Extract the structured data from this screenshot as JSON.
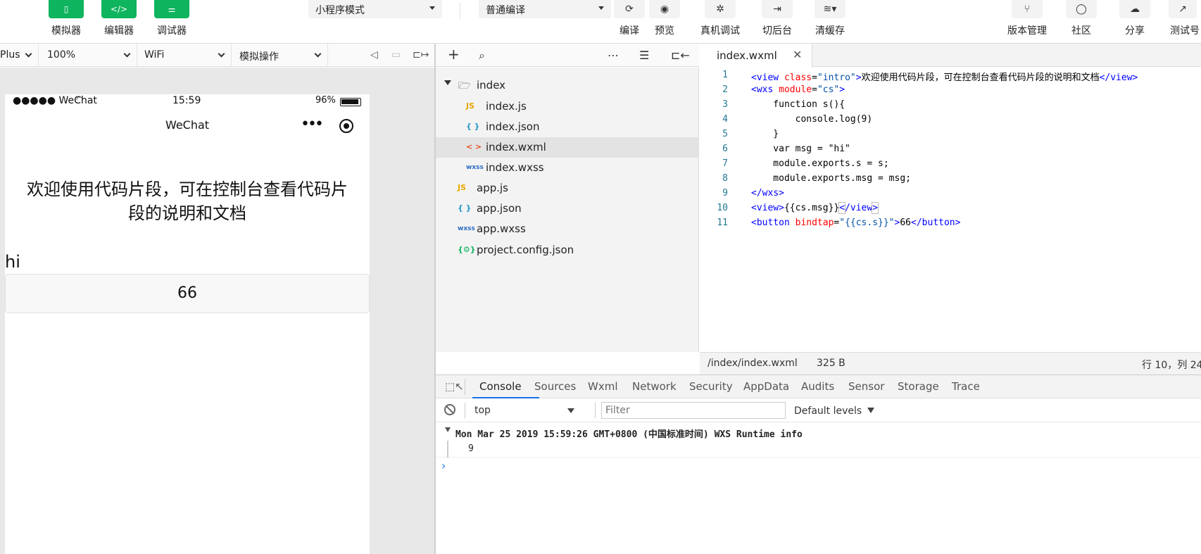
{
  "toolbar": {
    "simulator_label": "模拟器",
    "editor_label": "编辑器",
    "debugger_label": "调试器",
    "mode_select": "小程序模式",
    "compile_select": "普通编译",
    "compile_label": "编译",
    "preview_label": "预览",
    "remote_debug_label": "真机调试",
    "background_label": "切后台",
    "clear_cache_label": "清缓存",
    "version_label": "版本管理",
    "community_label": "社区",
    "share_label": "分享",
    "test_label": "测试号"
  },
  "simbar": {
    "device": "Plus",
    "zoom": "100%",
    "network": "WiFi",
    "operation": "模拟操作"
  },
  "phone": {
    "carrier": "●●●●● WeChat",
    "time": "15:59",
    "battery": "96%",
    "nav_title": "WeChat",
    "intro_text": "欢迎使用代码片段，可在控制台查看代码片段的说明和文档",
    "msg_text": "hi",
    "button_text": "66"
  },
  "tree": {
    "folder": "index",
    "files": [
      {
        "icon": "JS",
        "name": "index.js"
      },
      {
        "icon": "{ }",
        "name": "index.json"
      },
      {
        "icon": "< >",
        "name": "index.wxml"
      },
      {
        "icon": "wxss",
        "name": "index.wxss"
      },
      {
        "icon": "JS",
        "name": "app.js"
      },
      {
        "icon": "{ }",
        "name": "app.json"
      },
      {
        "icon": "wxss",
        "name": "app.wxss"
      },
      {
        "icon": "{⚙}",
        "name": "project.config.json"
      }
    ]
  },
  "editor": {
    "tab_name": "index.wxml",
    "line_numbers": [
      "1",
      "2",
      "3",
      "4",
      "5",
      "6",
      "7",
      "8",
      "9",
      "10",
      "11"
    ],
    "lines": {
      "l1_text": "欢迎使用代码片段，可在控制台查看代码片段的说明和文档",
      "l3": "    function s(){",
      "l4": "        console.log(9)",
      "l5": "    }",
      "l6": "    var msg = \"hi\"",
      "l7": "    module.exports.s = s;",
      "l8": "    module.exports.msg = msg;",
      "l10_text": "{{cs.msg}}",
      "l11_text": "66"
    },
    "status_path": "/index/index.wxml",
    "status_size": "325 B",
    "status_pos": "行 10，列 24"
  },
  "devtools": {
    "tabs": [
      "Console",
      "Sources",
      "Wxml",
      "Network",
      "Security",
      "AppData",
      "Audits",
      "Sensor",
      "Storage",
      "Trace"
    ],
    "context": "top",
    "filter_placeholder": "Filter",
    "levels": "Default levels",
    "log_header": "Mon Mar 25 2019 15:59:26 GMT+0800 (中国标准时间) WXS Runtime info",
    "log_value": "9"
  },
  "colors": {
    "accent_green": "#0fb45e",
    "tab_underline": "#1a73e8"
  }
}
